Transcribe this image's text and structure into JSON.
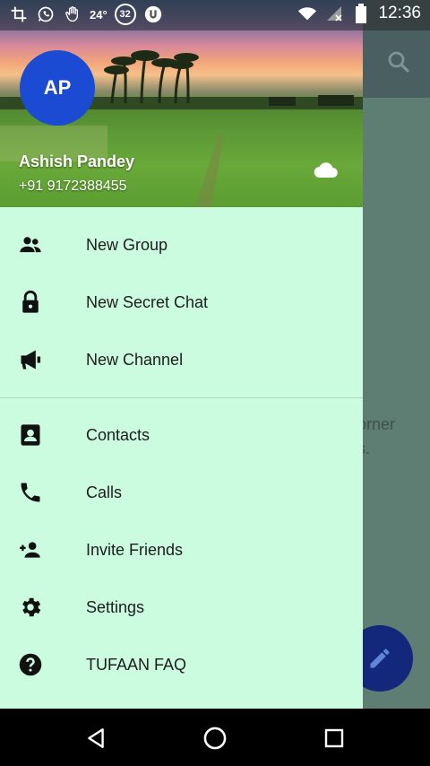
{
  "status_bar": {
    "left_icons": [
      "crop-icon",
      "whatsapp-icon",
      "hand-icon"
    ],
    "temperature": "24°",
    "badge_count": "32",
    "right_icons": [
      "wifi-icon",
      "signal-icon",
      "battery-icon"
    ],
    "time": "12:36"
  },
  "background_app": {
    "empty_text_line1": "orner",
    "empty_text_line2": "s.",
    "fab_icon": "pencil-icon"
  },
  "drawer": {
    "avatar_initials": "AP",
    "user_name": "Ashish Pandey",
    "user_phone": "+91 9172388455",
    "section1": [
      {
        "label": "New Group",
        "icon": "group-icon"
      },
      {
        "label": "New Secret Chat",
        "icon": "lock-icon"
      },
      {
        "label": "New Channel",
        "icon": "megaphone-icon"
      }
    ],
    "section2": [
      {
        "label": "Contacts",
        "icon": "contacts-icon"
      },
      {
        "label": "Calls",
        "icon": "phone-icon"
      },
      {
        "label": "Invite Friends",
        "icon": "add-person-icon"
      },
      {
        "label": "Settings",
        "icon": "gear-icon"
      },
      {
        "label": "TUFAAN FAQ",
        "icon": "help-icon"
      }
    ]
  },
  "colors": {
    "drawer_bg": "#ccfce0",
    "avatar_bg": "#1b4bd3",
    "fab_bg": "#13287a"
  }
}
